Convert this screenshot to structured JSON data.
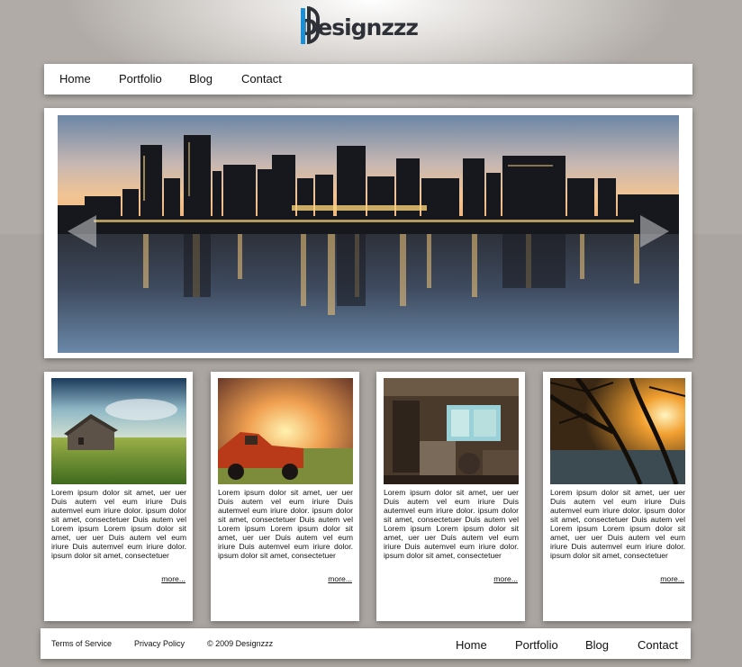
{
  "brand": {
    "name": "Designzzz"
  },
  "nav": {
    "items": [
      {
        "label": "Home"
      },
      {
        "label": "Portfolio"
      },
      {
        "label": "Blog"
      },
      {
        "label": "Contact"
      }
    ]
  },
  "slider": {
    "image": "city-skyline-night-reflection",
    "prev_icon": "left-triangle-arrow",
    "next_icon": "right-triangle-arrow"
  },
  "cards": [
    {
      "image": "house-in-field",
      "text": "Lorem ipsum dolor sit amet, uer uer Duis autem vel eum iriure Duis autemvel eum iriure dolor. ipsum dolor sit amet, consectetuer Duis autem vel Lorem ipsum Lorem ipsum dolor sit amet, uer uer Duis autem vel eum iriure Duis autemvel eum iriure dolor. ipsum dolor sit amet, consectetuer",
      "more": "more..."
    },
    {
      "image": "rusty-red-truck",
      "text": "Lorem ipsum dolor sit amet, uer uer Duis autem vel eum iriure Duis autemvel eum iriure dolor. ipsum dolor sit amet, consectetuer Duis autem vel Lorem ipsum Lorem ipsum dolor sit amet, uer uer Duis autem vel eum iriure Duis autemvel eum iriure dolor. ipsum dolor sit amet, consectetuer",
      "more": "more..."
    },
    {
      "image": "workshop-interior",
      "text": "Lorem ipsum dolor sit amet, uer uer Duis autem vel eum iriure Duis autemvel eum iriure dolor. ipsum dolor sit amet, consectetuer Duis autem vel Lorem ipsum Lorem ipsum dolor sit amet, uer uer Duis autem vel eum iriure Duis autemvel eum iriure dolor. ipsum dolor sit amet, consectetuer",
      "more": "more..."
    },
    {
      "image": "sunset-through-trees",
      "text": "Lorem ipsum dolor sit amet, uer uer Duis autem vel eum iriure Duis autemvel eum iriure dolor. ipsum dolor sit amet, consectetuer Duis autem vel Lorem ipsum Lorem ipsum dolor sit amet, uer uer Duis autem vel eum iriure Duis autemvel eum iriure dolor. ipsum dolor sit amet, consectetuer",
      "more": "more..."
    }
  ],
  "footer": {
    "links": [
      {
        "label": "Terms of Service"
      },
      {
        "label": "Privacy Policy"
      }
    ],
    "copyright": "© 2009 Designzzz",
    "nav": [
      {
        "label": "Home"
      },
      {
        "label": "Portfolio"
      },
      {
        "label": "Blog"
      },
      {
        "label": "Contact"
      }
    ]
  },
  "colors": {
    "accent": "#1a8fd6",
    "logo_dark": "#2e3238",
    "background": "#aaa5a0",
    "panel": "#ffffff"
  }
}
